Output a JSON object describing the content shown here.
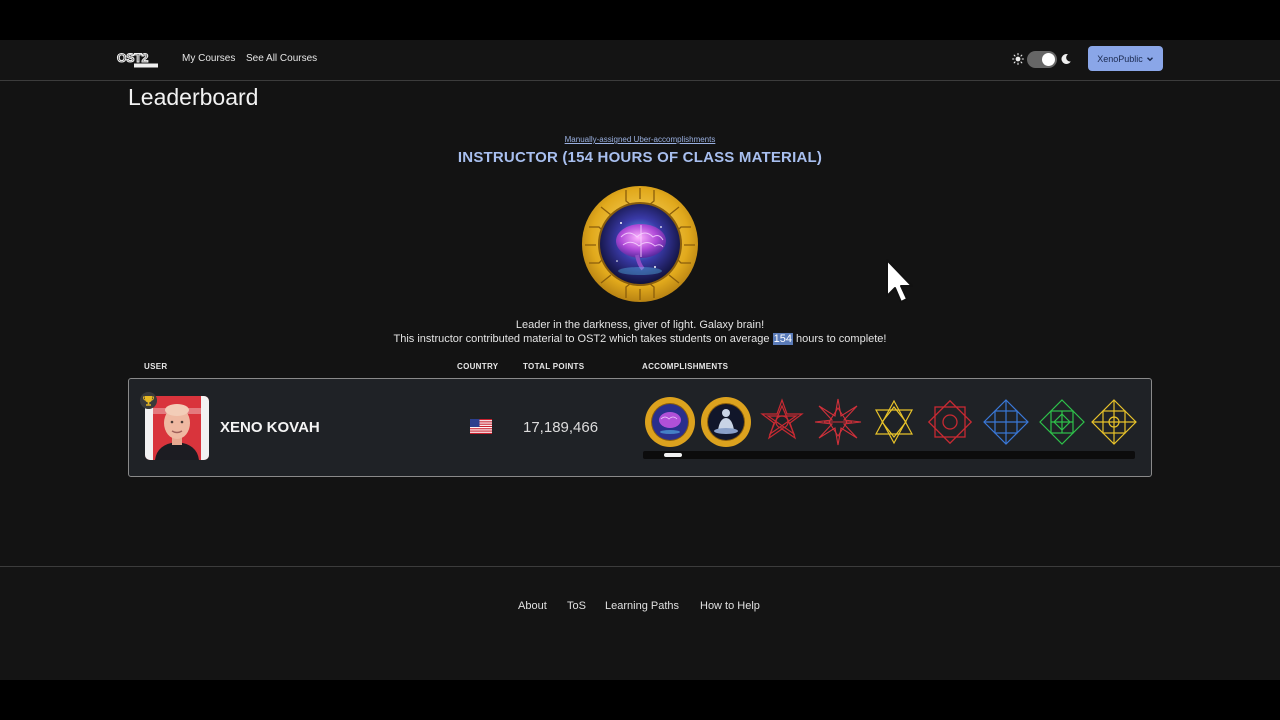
{
  "header": {
    "logo_text": "OST2",
    "nav": [
      {
        "label": "My Courses"
      },
      {
        "label": "See All Courses"
      }
    ],
    "user_menu_label": "XenoPublic"
  },
  "page": {
    "title": "Leaderboard",
    "award_link": "Manually-assigned Uber-accomplishments",
    "award_title": "INSTRUCTOR (154 HOURS OF CLASS MATERIAL)",
    "description_line1": "Leader in the darkness, giver of light. Galaxy brain!",
    "description_line2_pre": "This instructor contributed material to OST2 which takes students on average ",
    "description_hours": "154",
    "description_line2_post": " hours to complete!"
  },
  "table": {
    "headers": {
      "user": "USER",
      "country": "COUNTRY",
      "points": "TOTAL POINTS",
      "accomplishments": "ACCOMPLISHMENTS"
    },
    "rows": [
      {
        "name": "XENO KOVAH",
        "country_icon": "us-flag-icon",
        "points": "17,189,466",
        "badges": [
          "galaxy-brain-badge-icon",
          "meditation-badge-icon",
          "red-star-badge-icon",
          "red-starburst-badge-icon",
          "yellow-star-badge-icon",
          "red-octagram-badge-icon",
          "blue-lattice-badge-icon",
          "green-lattice-badge-icon",
          "yellow-lattice-badge-icon"
        ],
        "scroll_fraction": 0.04
      }
    ]
  },
  "footer": {
    "links": [
      {
        "label": "About"
      },
      {
        "label": "ToS"
      },
      {
        "label": "Learning Paths"
      },
      {
        "label": "How to Help"
      }
    ]
  },
  "colors": {
    "accent": "#a8bfef",
    "user_menu_bg": "#8aa6e8",
    "gold": "#e8b923",
    "background": "#131313"
  }
}
